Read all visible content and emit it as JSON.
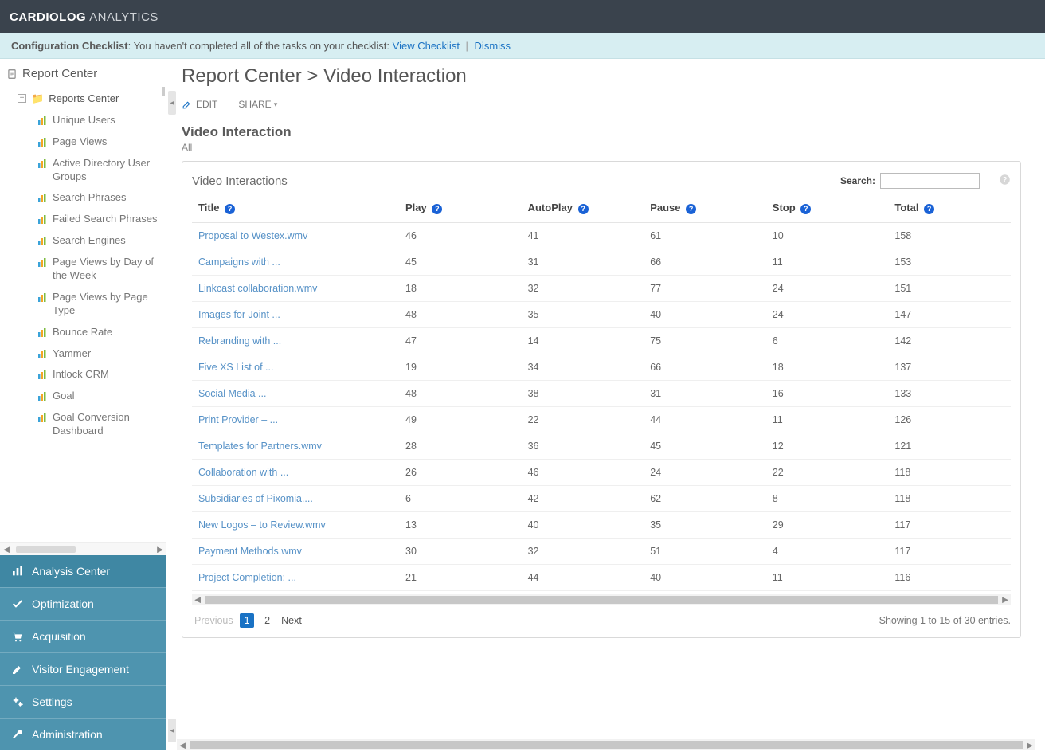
{
  "brand": {
    "strong": "CARDIOLOG",
    "light": "ANALYTICS"
  },
  "banner": {
    "title": "Configuration Checklist",
    "text": ": You haven't completed all of the tasks on your checklist: ",
    "view": "View Checklist",
    "dismiss": "Dismiss"
  },
  "sidebar": {
    "header": "Report Center",
    "root": "Reports Center",
    "items": [
      "Unique Users",
      "Page Views",
      "Active Directory User Groups",
      "Search Phrases",
      "Failed Search Phrases",
      "Search Engines",
      "Page Views by Day of the Week",
      "Page Views by Page Type",
      "Bounce Rate",
      "Yammer",
      "Intlock CRM",
      "Goal",
      "Goal Conversion Dashboard"
    ]
  },
  "bottom_nav": [
    "Analysis Center",
    "Optimization",
    "Acquisition",
    "Visitor Engagement",
    "Settings",
    "Administration"
  ],
  "breadcrumb": "Report Center > Video Interaction",
  "toolbar": {
    "edit": "EDIT",
    "share": "SHARE"
  },
  "section": {
    "title": "Video Interaction",
    "sub": "All"
  },
  "panel": {
    "title": "Video Interactions",
    "search_label": "Search:",
    "columns": [
      "Title",
      "Play",
      "AutoPlay",
      "Pause",
      "Stop",
      "Total"
    ],
    "rows": [
      {
        "title": "Proposal to Westex.wmv",
        "play": 46,
        "autoplay": 41,
        "pause": 61,
        "stop": 10,
        "total": 158
      },
      {
        "title": "Campaigns with ...",
        "play": 45,
        "autoplay": 31,
        "pause": 66,
        "stop": 11,
        "total": 153
      },
      {
        "title": "Linkcast collaboration.wmv",
        "play": 18,
        "autoplay": 32,
        "pause": 77,
        "stop": 24,
        "total": 151
      },
      {
        "title": "Images for Joint ...",
        "play": 48,
        "autoplay": 35,
        "pause": 40,
        "stop": 24,
        "total": 147
      },
      {
        "title": "Rebranding with ...",
        "play": 47,
        "autoplay": 14,
        "pause": 75,
        "stop": 6,
        "total": 142
      },
      {
        "title": "Five XS List of ...",
        "play": 19,
        "autoplay": 34,
        "pause": 66,
        "stop": 18,
        "total": 137
      },
      {
        "title": "Social Media ...",
        "play": 48,
        "autoplay": 38,
        "pause": 31,
        "stop": 16,
        "total": 133
      },
      {
        "title": "Print Provider – ...",
        "play": 49,
        "autoplay": 22,
        "pause": 44,
        "stop": 11,
        "total": 126
      },
      {
        "title": "Templates for Partners.wmv",
        "play": 28,
        "autoplay": 36,
        "pause": 45,
        "stop": 12,
        "total": 121
      },
      {
        "title": "Collaboration with ...",
        "play": 26,
        "autoplay": 46,
        "pause": 24,
        "stop": 22,
        "total": 118
      },
      {
        "title": "Subsidiaries of Pixomia....",
        "play": 6,
        "autoplay": 42,
        "pause": 62,
        "stop": 8,
        "total": 118
      },
      {
        "title": "New Logos – to Review.wmv",
        "play": 13,
        "autoplay": 40,
        "pause": 35,
        "stop": 29,
        "total": 117
      },
      {
        "title": "Payment Methods.wmv",
        "play": 30,
        "autoplay": 32,
        "pause": 51,
        "stop": 4,
        "total": 117
      },
      {
        "title": "Project Completion: ...",
        "play": 21,
        "autoplay": 44,
        "pause": 40,
        "stop": 11,
        "total": 116
      }
    ],
    "pager": {
      "prev": "Previous",
      "pages": [
        "1",
        "2"
      ],
      "next": "Next"
    },
    "status": "Showing 1 to 15 of 30 entries."
  }
}
